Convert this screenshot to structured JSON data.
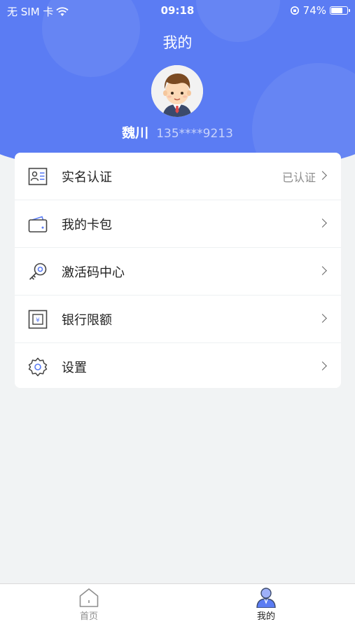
{
  "status_bar": {
    "carrier": "无 SIM 卡",
    "time": "09:18",
    "battery": "74%",
    "battery_level": 0.74
  },
  "header": {
    "title": "我的",
    "user_name": "魏川",
    "phone": "135****9213"
  },
  "menu": [
    {
      "label": "实名认证",
      "value": "已认证",
      "icon": "id-card-icon"
    },
    {
      "label": "我的卡包",
      "value": "",
      "icon": "wallet-icon"
    },
    {
      "label": "激活码中心",
      "value": "",
      "icon": "key-icon"
    },
    {
      "label": "银行限额",
      "value": "",
      "icon": "bank-limit-icon"
    },
    {
      "label": "设置",
      "value": "",
      "icon": "gear-icon"
    }
  ],
  "tabbar": {
    "tabs": [
      {
        "label": "首页",
        "icon": "home-icon",
        "active": false
      },
      {
        "label": "我的",
        "icon": "profile-icon",
        "active": true
      }
    ],
    "colors": {
      "active": "#222222",
      "inactive": "#8e8e8e"
    }
  },
  "colors": {
    "primary": "#5b7cf3",
    "background": "#f1f3f4"
  }
}
